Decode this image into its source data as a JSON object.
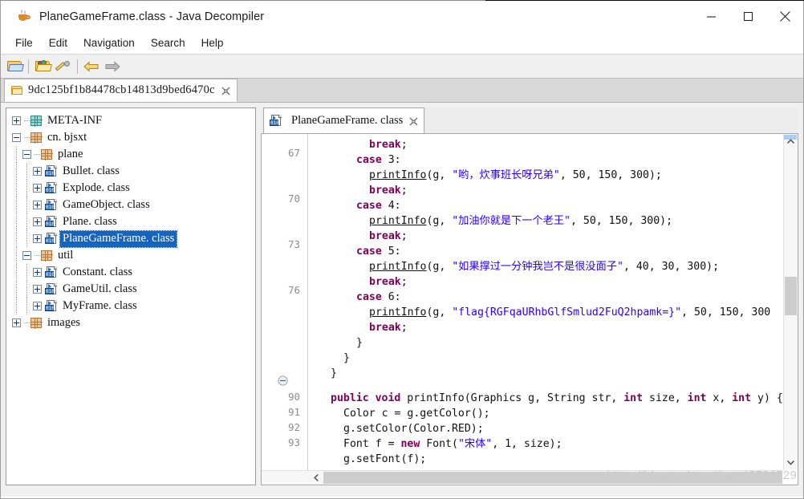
{
  "window": {
    "title": "PlaneGameFrame.class - Java Decompiler",
    "app_icon": "java-coffee-cup-icon",
    "minimize_label": "Minimize",
    "maximize_label": "Maximize",
    "close_label": "Close"
  },
  "menubar": {
    "items": [
      {
        "label": "File"
      },
      {
        "label": "Edit"
      },
      {
        "label": "Navigation"
      },
      {
        "label": "Search"
      },
      {
        "label": "Help"
      }
    ]
  },
  "toolbar": {
    "buttons": [
      {
        "name": "open-file-icon",
        "title": "Open File"
      },
      {
        "name": "open-type-icon",
        "title": "Open Type"
      },
      {
        "name": "magic-wand-icon",
        "title": "Decompile"
      },
      {
        "name": "back-arrow-icon",
        "title": "Back"
      },
      {
        "name": "forward-arrow-icon",
        "title": "Forward"
      }
    ]
  },
  "archive_tabs": [
    {
      "label": "9dc125bf1b84478cb14813d9bed6470c",
      "icon": "folder-icon",
      "close": "close-icon",
      "active": true
    }
  ],
  "tree": {
    "nodes": [
      {
        "label": "META-INF",
        "indent": 0,
        "icon": "package-icon-teal",
        "expander": "plus",
        "selected": false
      },
      {
        "label": "cn. bjsxt",
        "indent": 0,
        "icon": "package-icon",
        "expander": "minus",
        "selected": false
      },
      {
        "label": "plane",
        "indent": 1,
        "icon": "package-icon",
        "expander": "minus",
        "selected": false
      },
      {
        "label": "Bullet. class",
        "indent": 2,
        "icon": "class-file-icon",
        "expander": "plus",
        "selected": false
      },
      {
        "label": "Explode. class",
        "indent": 2,
        "icon": "class-file-icon",
        "expander": "plus",
        "selected": false
      },
      {
        "label": "GameObject. class",
        "indent": 2,
        "icon": "class-file-icon",
        "expander": "plus",
        "selected": false
      },
      {
        "label": "Plane. class",
        "indent": 2,
        "icon": "class-file-icon",
        "expander": "plus",
        "selected": false
      },
      {
        "label": "PlaneGameFrame. class",
        "indent": 2,
        "icon": "class-file-icon",
        "expander": "plus",
        "selected": true
      },
      {
        "label": "util",
        "indent": 1,
        "icon": "package-icon",
        "expander": "minus",
        "selected": false
      },
      {
        "label": "Constant. class",
        "indent": 2,
        "icon": "class-file-icon",
        "expander": "plus",
        "selected": false
      },
      {
        "label": "GameUtil. class",
        "indent": 2,
        "icon": "class-file-icon",
        "expander": "plus",
        "selected": false
      },
      {
        "label": "MyFrame. class",
        "indent": 2,
        "icon": "class-file-icon",
        "expander": "plus",
        "selected": false
      },
      {
        "label": "images",
        "indent": 0,
        "icon": "package-icon",
        "expander": "plus",
        "selected": false
      }
    ]
  },
  "editor": {
    "tabs": [
      {
        "label": "PlaneGameFrame. class",
        "icon": "class-file-icon",
        "close": "close-icon",
        "active": true
      }
    ],
    "gutter_numbers": [
      "67",
      "70",
      "73",
      "76",
      "90",
      "91",
      "92",
      "93"
    ],
    "fold_marker": "collapse-icon",
    "lines": [
      {
        "text": "break;",
        "indent": 8
      },
      {
        "text": "case 3:",
        "indent": 6
      },
      {
        "text": "printInfo(g, \"哟，炊事班长呀兄弟\", 50, 150, 300);",
        "indent": 8
      },
      {
        "text": "break;",
        "indent": 8
      },
      {
        "text": "case 4:",
        "indent": 6
      },
      {
        "text": "printInfo(g, \"加油你就是下一个老王\", 50, 150, 300);",
        "indent": 8
      },
      {
        "text": "break;",
        "indent": 8
      },
      {
        "text": "case 5:",
        "indent": 6
      },
      {
        "text": "printInfo(g, \"如果撑过一分钟我岂不是很没面子\", 40, 30, 300);",
        "indent": 8
      },
      {
        "text": "break;",
        "indent": 8
      },
      {
        "text": "case 6:",
        "indent": 6
      },
      {
        "text": "printInfo(g, \"flag{RGFqaURhbGlfSmlud2FuQ2hpamk=}\", 50, 150, 300",
        "indent": 8
      },
      {
        "text": "break;",
        "indent": 8
      },
      {
        "text": "}",
        "indent": 6
      },
      {
        "text": "}",
        "indent": 4
      },
      {
        "text": "}",
        "indent": 2
      },
      {
        "text": "",
        "indent": 0
      },
      {
        "text": "public void printInfo(Graphics g, String str, int size, int x, int y) {",
        "indent": 2
      },
      {
        "text": "Color c = g.getColor();",
        "indent": 4
      },
      {
        "text": "g.setColor(Color.RED);",
        "indent": 4
      },
      {
        "text": "Font f = new Font(\"宋体\", 1, size);",
        "indent": 4
      },
      {
        "text": "g.setFont(f);",
        "indent": 4
      }
    ],
    "flag_string": "flag{RGFqaURhbGlfSmlud2FuQ2hpamk=}",
    "strings": [
      "哟，炊事班长呀兄弟",
      "加油你就是下一个老王",
      "如果撑过一分钟我岂不是很没面子",
      "flag{RGFqaURhbGlfSmlud2FuQ2hpamk=}",
      "宋体"
    ],
    "vertical_scrollbar": {
      "up": "chevron-up-icon",
      "down": "chevron-down-icon"
    },
    "horizontal_scrollbar": {
      "left": "chevron-left-icon"
    }
  },
  "watermark": "https://blog.csdn.net/qq_45786729",
  "colors": {
    "selection": "#1565c0",
    "keyword": "#7f0055",
    "string": "#2a00ff",
    "gutter_text": "#8d8d8d",
    "toolbar_bg": "#f0f0f0",
    "accent_blue": "#a8cdf0"
  }
}
